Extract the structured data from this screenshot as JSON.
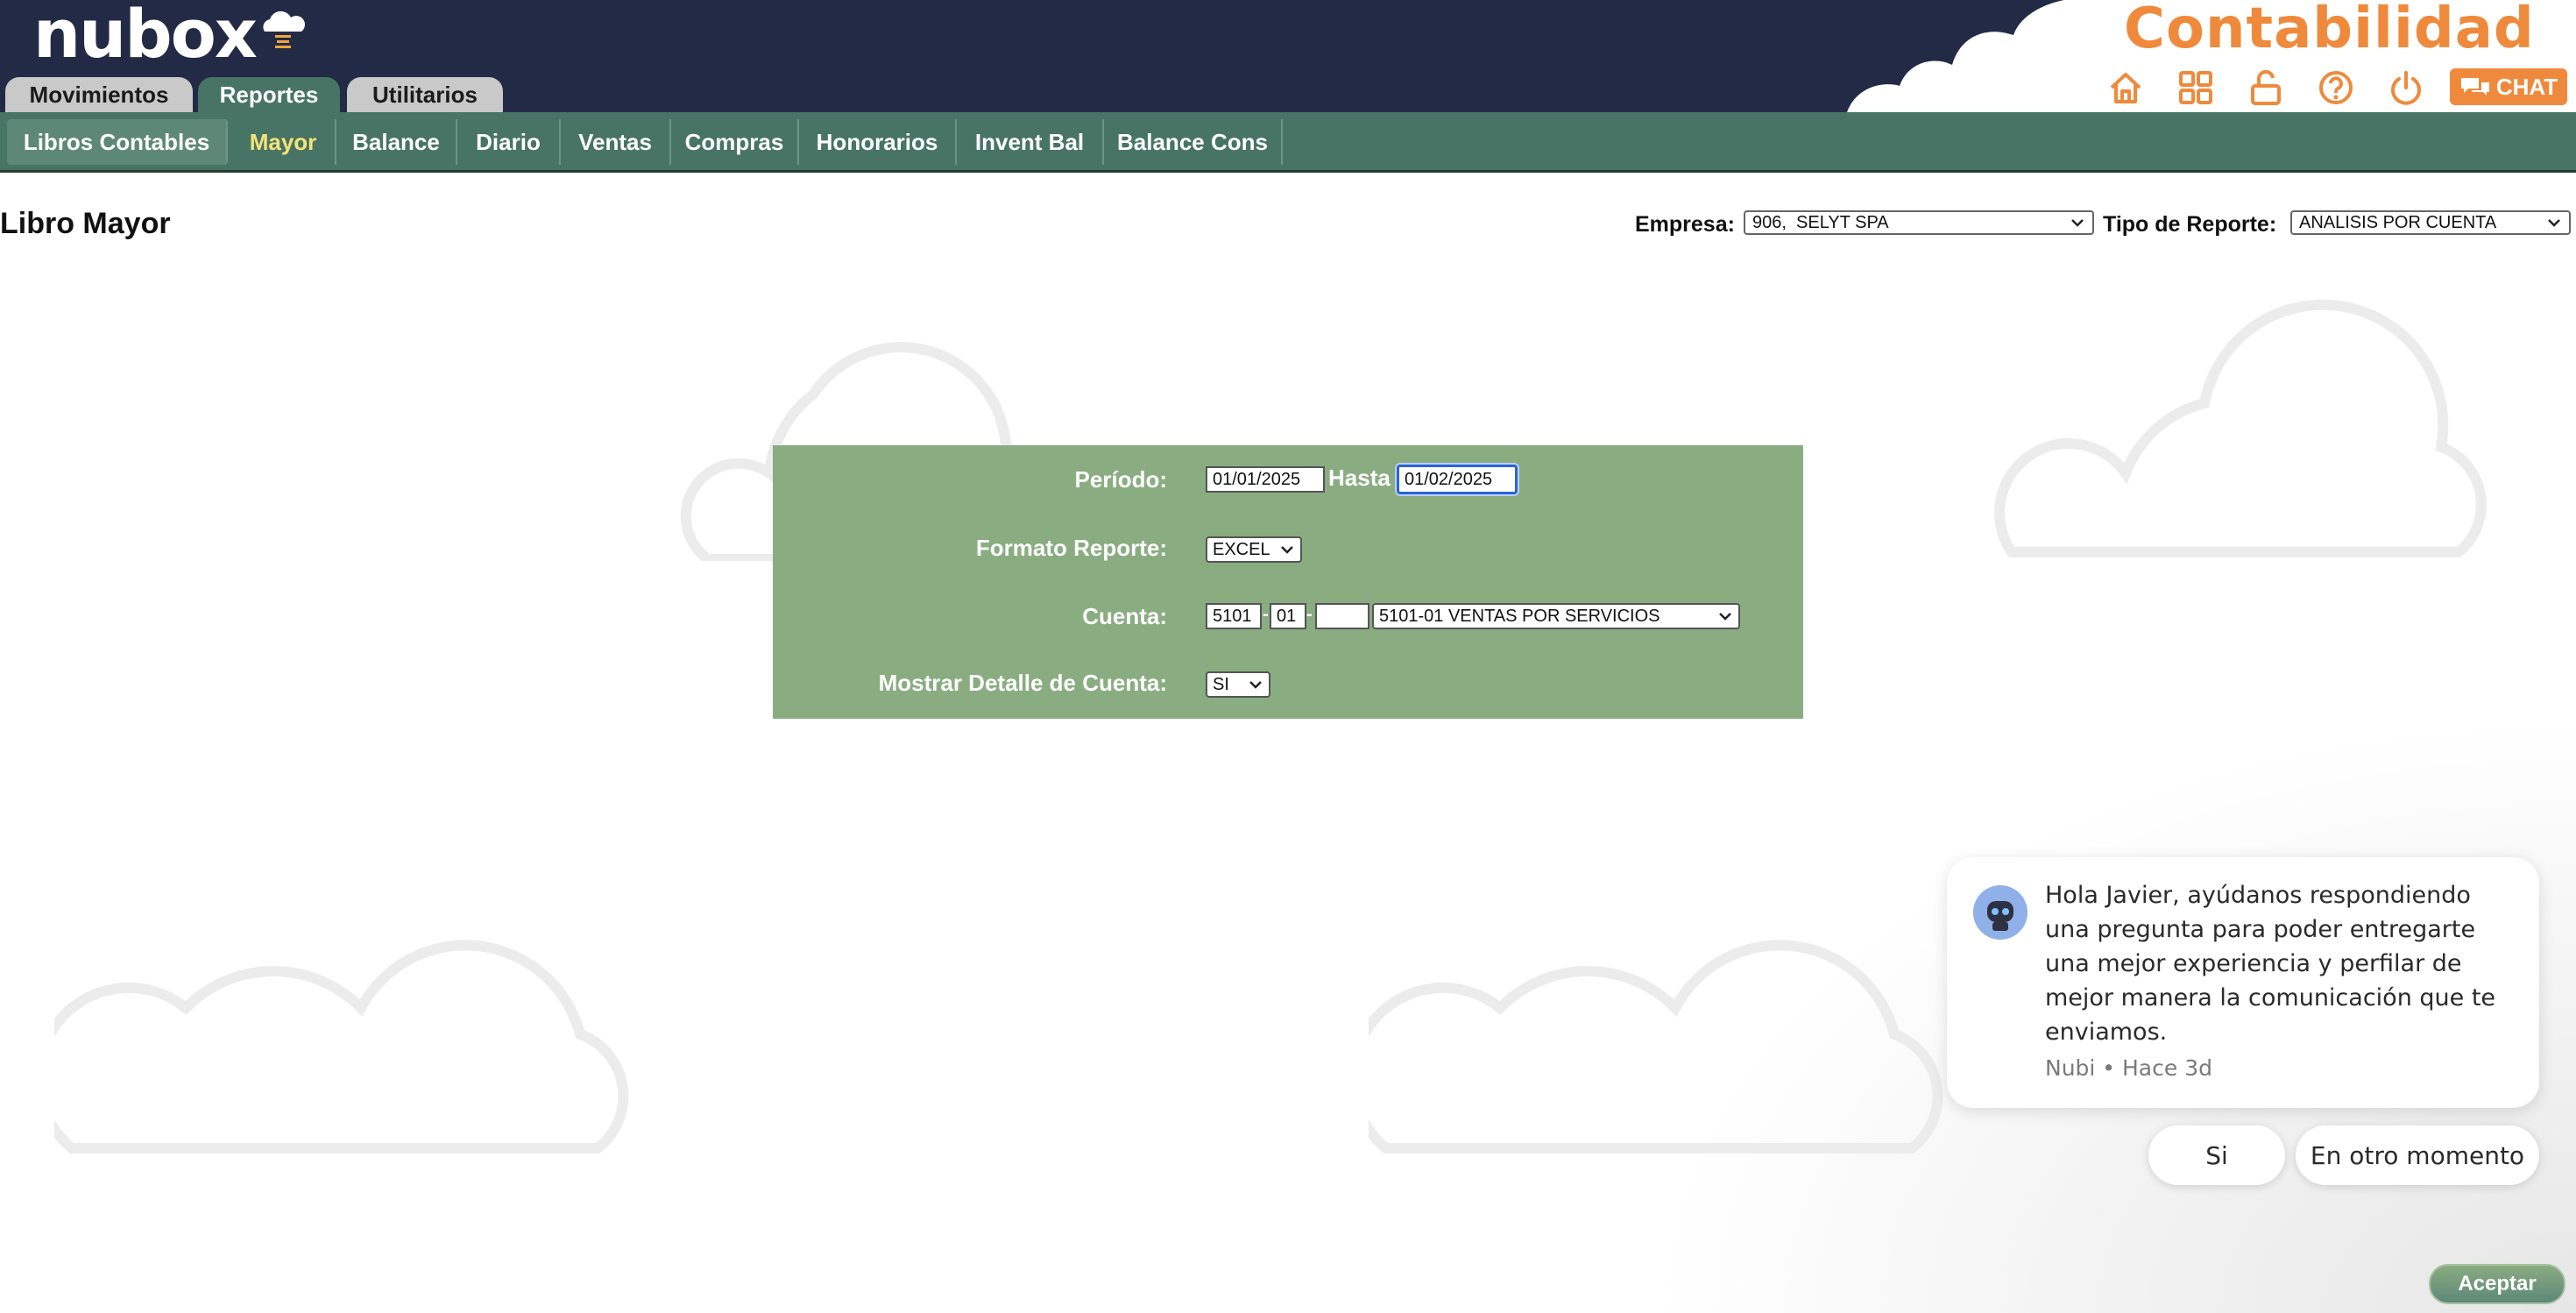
{
  "header": {
    "logo": "nubox",
    "brand": "Contabilidad",
    "chat_label": "CHAT",
    "icons": [
      "home-icon",
      "apps-grid-icon",
      "unlock-icon",
      "help-icon",
      "power-icon"
    ]
  },
  "tabs": [
    {
      "label": "Movimientos",
      "active": false
    },
    {
      "label": "Reportes",
      "active": true
    },
    {
      "label": "Utilitarios",
      "active": false
    }
  ],
  "subnav": [
    {
      "label": "Libros Contables"
    },
    {
      "label": "Mayor",
      "selected": true
    },
    {
      "label": "Balance"
    },
    {
      "label": "Diario"
    },
    {
      "label": "Ventas"
    },
    {
      "label": "Compras"
    },
    {
      "label": "Honorarios"
    },
    {
      "label": "Invent Bal"
    },
    {
      "label": "Balance Cons"
    }
  ],
  "page": {
    "title": "Libro Mayor",
    "empresa_label": "Empresa:",
    "empresa_value": "906,  SELYT SPA",
    "tipo_label": "Tipo de Reporte:",
    "tipo_value": "ANALISIS POR CUENTA"
  },
  "form": {
    "periodo_label": "Período:",
    "periodo_desde": "01/01/2025",
    "hasta_label": "Hasta",
    "periodo_hasta": "01/02/2025",
    "formato_label": "Formato Reporte:",
    "formato_value": "EXCEL",
    "cuenta_label": "Cuenta:",
    "cuenta_1": "5101",
    "cuenta_2": "01",
    "cuenta_3": "",
    "cuenta_sep": "-",
    "cuenta_select": "5101-01 VENTAS POR SERVICIOS",
    "detalle_label": "Mostrar Detalle de Cuenta:",
    "detalle_value": "SI"
  },
  "notification": {
    "message": "Hola Javier, ayúdanos respondiendo una pregunta para poder entregarte una mejor experiencia y perfilar de mejor manera la comunicación que te enviamos.",
    "meta": "Nubi • Hace 3d",
    "reply_yes": "Si",
    "reply_later": "En otro momento"
  },
  "footer": {
    "accept_label": "Aceptar"
  },
  "colors": {
    "topbar": "#232a45",
    "subnav": "#477465",
    "panel": "#8aac81",
    "brand": "#ef8a3c",
    "selected_subnav": "#f4e37a"
  }
}
